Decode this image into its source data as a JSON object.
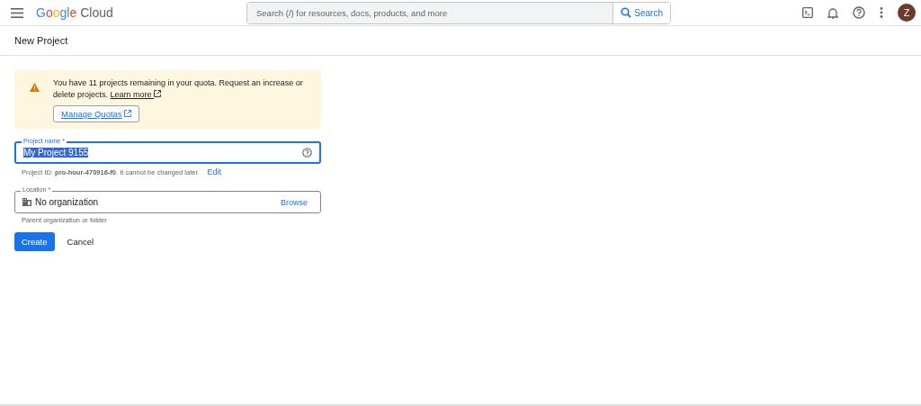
{
  "header": {
    "logo": {
      "brand": "Google",
      "product": "Cloud"
    },
    "search": {
      "placeholder": "Search (/) for resources, docs, products, and more",
      "button": "Search"
    },
    "avatar": "Z"
  },
  "page_title": "New Project",
  "quota_notice": {
    "message": "You have 11 projects remaining in your quota. Request an increase or delete projects.",
    "link": "Learn more",
    "button": "Manage Quotas"
  },
  "project_name": {
    "label": "Project name *",
    "value": "My Project 9155",
    "selected": true,
    "hint": "Project ID: **pro-hour-470916-f0**. It cannot be changed later.",
    "edit": "Edit"
  },
  "location": {
    "label": "Location *",
    "value": "No organization",
    "browse": "Browse",
    "hint": "Parent organization or folder"
  },
  "buttons": {
    "create": "Create",
    "cancel": "Cancel"
  }
}
